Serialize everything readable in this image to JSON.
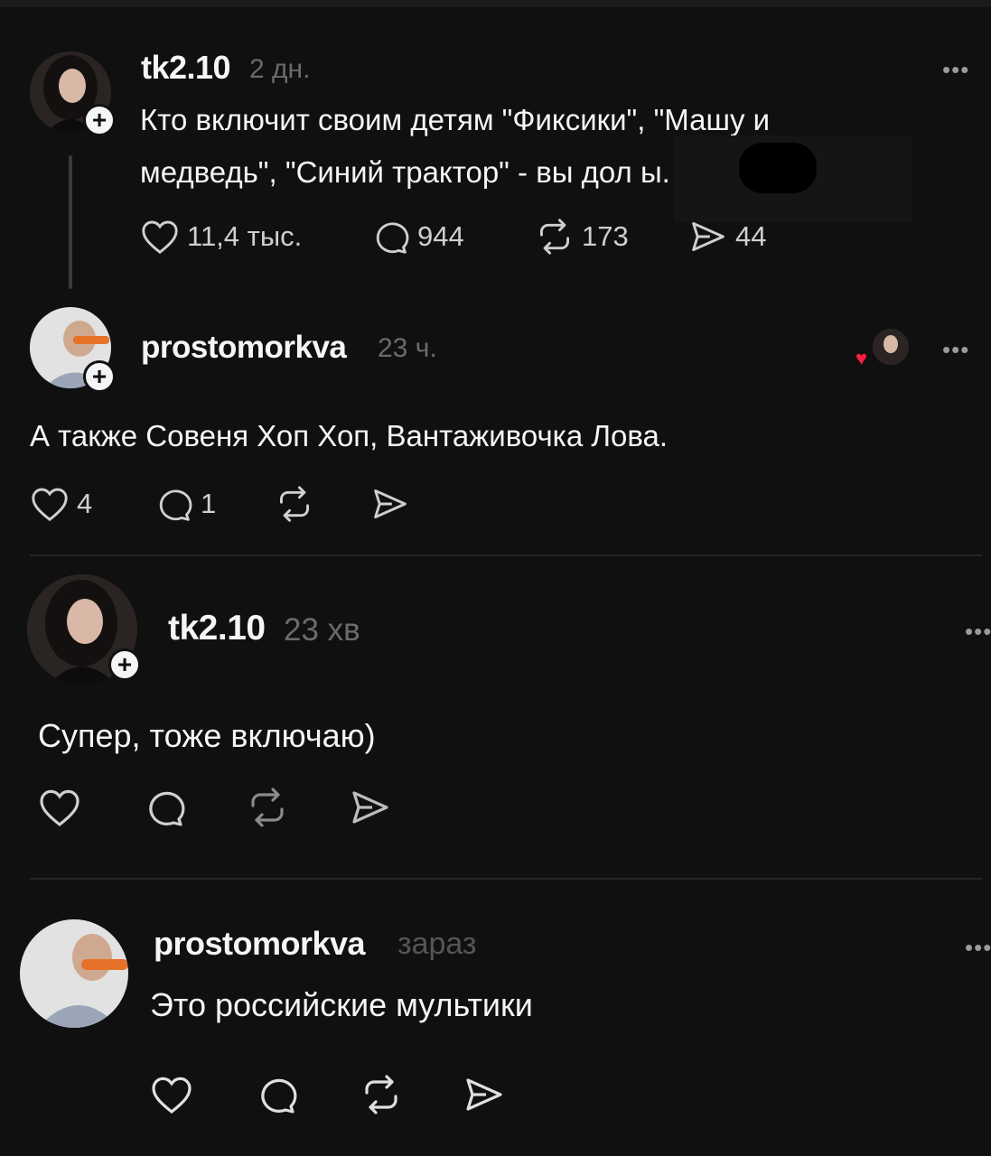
{
  "post": {
    "username": "tk2.10",
    "time": "2 дн.",
    "text": "Кто включит своим детям \"Фиксики\", \"Машу и\nмедведь\", \"Синий трактор\" - вы дол      ы.",
    "likes": "11,4 тыс.",
    "replies": "944",
    "reposts": "173",
    "shares": "44"
  },
  "comments": [
    {
      "username": "prostomorkva",
      "time": "23 ч.",
      "text": "А также Совеня Хоп Хоп, Вантаживочка Лова.",
      "likes": "4",
      "replies": "1"
    },
    {
      "username": "tk2.10",
      "time": "23 хв",
      "text": "Супер, тоже включаю)"
    },
    {
      "username": "prostomorkva",
      "time": "зараз",
      "text": "Это российские мультики"
    }
  ],
  "more_label": "•••",
  "plus_label": "+",
  "icons": [
    "heart-icon",
    "comment-icon",
    "repost-icon",
    "share-icon",
    "more-icon",
    "follow-plus-icon"
  ],
  "colors": {
    "background": "#101010",
    "text": "#f3f5f7",
    "muted": "#6b6b6b",
    "liked_heart": "#ff1f3a"
  }
}
